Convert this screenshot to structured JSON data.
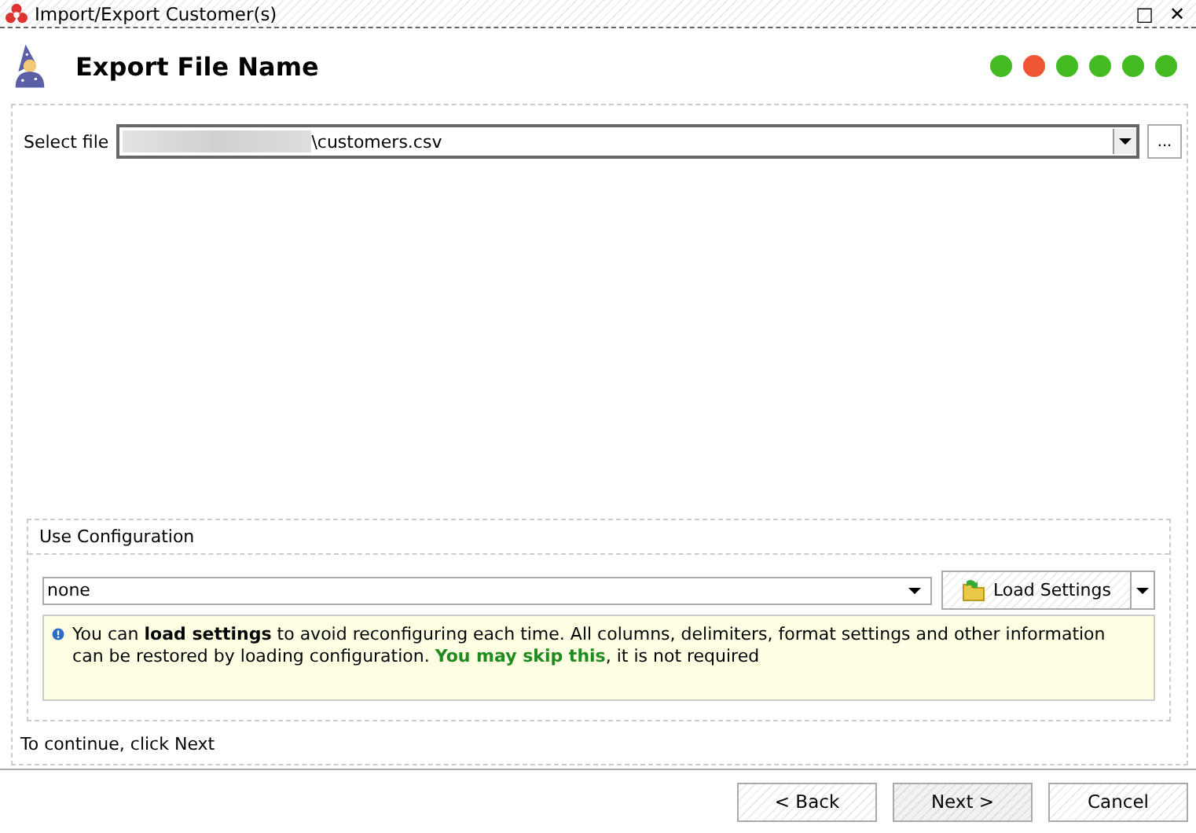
{
  "window": {
    "title": "Import/Export Customer(s)",
    "buttons": [
      "□",
      "✕"
    ]
  },
  "header": {
    "title": "Export File Name",
    "steps": [
      {
        "color": "#44bb22"
      },
      {
        "color": "#ee5533"
      },
      {
        "color": "#44bb22"
      },
      {
        "color": "#44bb22"
      },
      {
        "color": "#44bb22"
      },
      {
        "color": "#44bb22"
      }
    ]
  },
  "select_file": {
    "label": "Select file",
    "value": "\\customers.csv",
    "browse": "..."
  },
  "configuration": {
    "title": "Use Configuration",
    "value": "none",
    "load_button": "Load Settings",
    "info": "You can **load settings** to avoid reconfiguring each time. All columns, delimiters, format settings and other information can be restored by loading configuration. ",
    "info_highlight": "You may skip this",
    "info_tail": ", it is not required"
  },
  "hint": "To continue, click Next",
  "buttons": [
    {
      "label": "< Back",
      "kind": "normal"
    },
    {
      "label": "Next >",
      "kind": "default"
    },
    {
      "label": "Cancel",
      "kind": "normal"
    }
  ]
}
